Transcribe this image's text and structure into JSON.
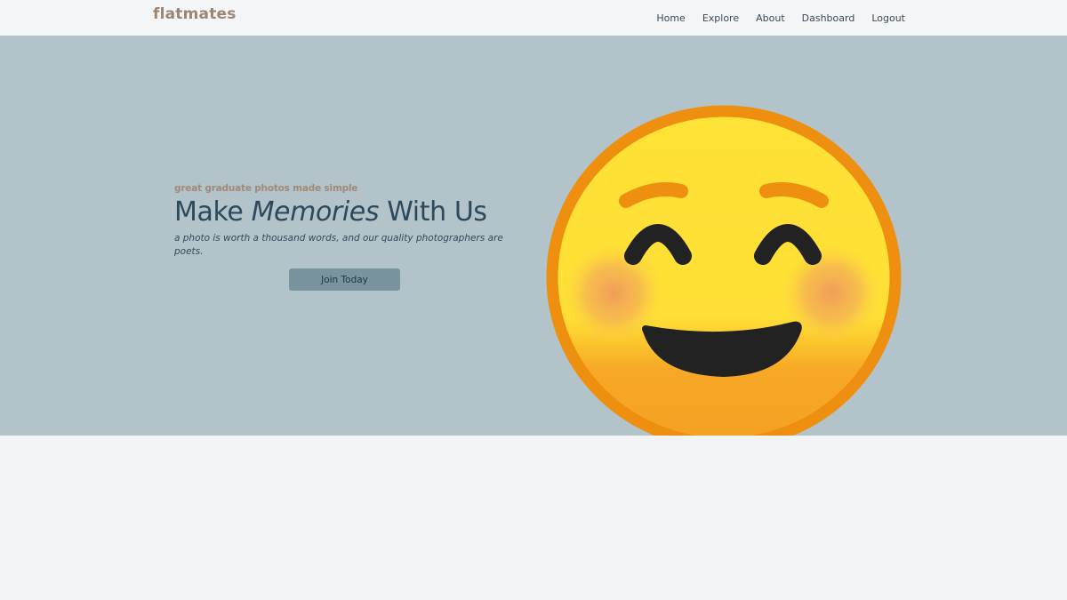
{
  "navbar": {
    "brand": "flatmates",
    "links": [
      {
        "label": "Home"
      },
      {
        "label": "Explore"
      },
      {
        "label": "About"
      },
      {
        "label": "Dashboard"
      },
      {
        "label": "Logout"
      }
    ]
  },
  "hero": {
    "tagline": "great graduate photos made simple",
    "headline_prefix": "Make ",
    "headline_emphasis": "Memories",
    "headline_suffix": " With Us",
    "subtext": "a photo is worth a thousand words, and our quality photographers are poets.",
    "cta_label": "Join Today",
    "image_icon": "smiling-face-emoji-icon"
  },
  "colors": {
    "brand": "#9b8574",
    "hero_background": "#b2c3ca",
    "headline": "#2d4a5c",
    "cta_background": "#7a949f",
    "page_background": "#f3f4f6"
  }
}
